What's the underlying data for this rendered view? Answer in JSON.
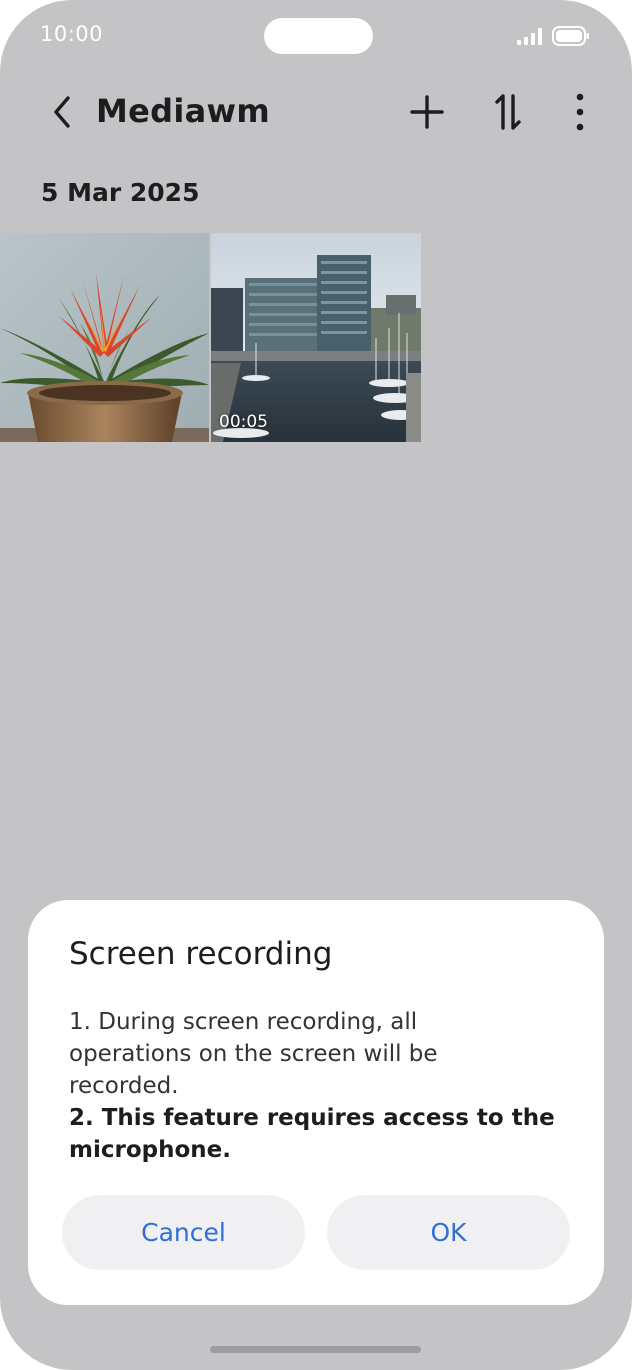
{
  "status_bar": {
    "time": "10:00"
  },
  "header": {
    "title": "Mediawm",
    "back_icon": "chevron-left-icon",
    "actions": [
      "plus-icon",
      "sort-icon",
      "more-vertical-icon"
    ]
  },
  "gallery": {
    "date": "5 Mar 2025",
    "items": [
      {
        "type": "photo",
        "subject": "potted bromeliad plant"
      },
      {
        "type": "video",
        "subject": "harbour with glass office buildings",
        "duration": "00:05"
      }
    ]
  },
  "dialog": {
    "title": "Screen recording",
    "line1": "1. During screen recording, all",
    "line2": "operations on the screen will be",
    "line3": "recorded.",
    "line4": "2. This feature requires access to the",
    "line5": "microphone.",
    "cancel_label": "Cancel",
    "ok_label": "OK"
  },
  "colors": {
    "background": "#c4c4c6",
    "accent": "#2f6fd8",
    "dialog_bg": "#ffffff",
    "button_bg": "#f0f0f2"
  }
}
